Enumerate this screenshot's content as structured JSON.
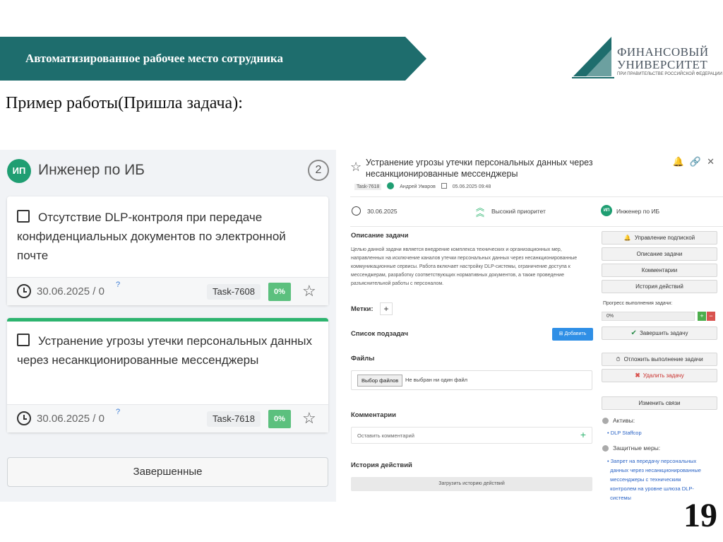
{
  "slide": {
    "title": "Автоматизированное рабочее место сотрудника",
    "subtitle": "Пример работы(Пришла задача):",
    "page_number": "19",
    "banner_color": "#1e6d6d",
    "logo": {
      "line1": "ФИНАНСОВЫЙ",
      "line2": "УНИВЕРСИТЕТ",
      "line3": "ПРИ ПРАВИТЕЛЬСТВЕ РОССИЙСКОЙ ФЕДЕРАЦИИ"
    }
  },
  "board": {
    "avatar": "ИП",
    "column_title": "Инженер по ИБ",
    "count": "2",
    "cards": [
      {
        "title": "Отсутствие DLP-контроля при передаче конфиденциальных документов по электронной почте",
        "due": "30.06.2025 / 0",
        "help": "?",
        "task_id": "Task-7608",
        "progress_label": "0%",
        "progress": 0
      },
      {
        "title": "Устранение угрозы утечки персональных данных через несанкционированные мессенджеры",
        "due": "30.06.2025 / 0",
        "help": "?",
        "task_id": "Task-7618",
        "progress_label": "0%",
        "progress": 0
      }
    ],
    "completed_label": "Завершенные",
    "accent_color": "#2db46f"
  },
  "detail": {
    "title": "Устранение угрозы утечки персональных данных через несанкционированные мессенджеры",
    "task_tag": "Task-7618",
    "author": "Андрей Умаров",
    "created": "05.06.2025 09:48",
    "due_date": "30.06.2025",
    "priority": "Высокий приоритет",
    "assignee_avatar": "ИП",
    "assignee": "Инженер по ИБ",
    "description_heading": "Описание задачи",
    "description": "Целью данной задачи является внедрение комплекса технических и организационных мер, направленных на исключение каналов утечки персональных данных через несанкционированные коммуникационные сервисы. Работа включает настройку DLP-системы, ограничение доступа к мессенджерам, разработку соответствующих нормативных документов, а также проведение разъяснительной работы с персоналом.",
    "tags_label": "Метки:",
    "tags_add": "+",
    "subtasks_heading": "Список подзадач",
    "subtasks_add": "Добавить",
    "files_heading": "Файлы",
    "file_button": "Выбор файлов",
    "file_status": "Не выбран ни один файл",
    "comments_heading": "Комментарии",
    "comment_placeholder": "Оставить комментарий",
    "comment_add": "+",
    "history_heading": "История действий",
    "history_button": "Загрузить историю действий",
    "sidebar": {
      "subscriptions": "Управление подпиской",
      "description": "Описание задачи",
      "comments": "Комментарии",
      "history": "История действий",
      "progress_label": "Прогресс выполнения задачи:",
      "progress_value": "0%",
      "progress": 0,
      "progress_plus": "+",
      "progress_minus": "−",
      "complete": "Завершить задачу",
      "postpone": "Отложить выполнение задачи",
      "delete": "Удалить задачу",
      "change_links": "Изменить связи",
      "assets_heading": "Активы:",
      "assets": [
        "DLP Staffcop"
      ],
      "measures_heading": "Защитные меры:",
      "measures": [
        "Запрет на передачу персональных",
        "данных через несанкционированные",
        "мессенджеры с техническим",
        "контролем на уровне шлюза DLP-",
        "системы"
      ]
    }
  }
}
